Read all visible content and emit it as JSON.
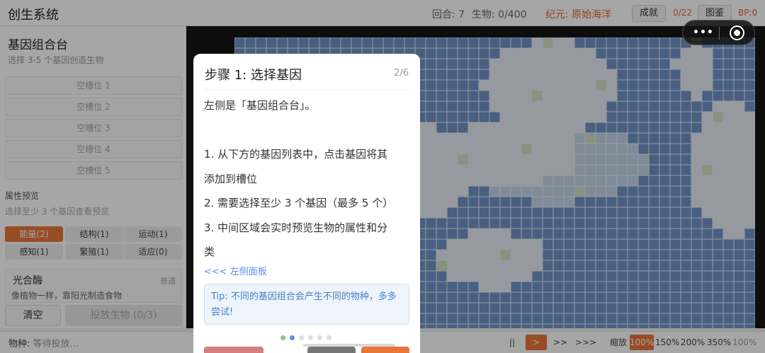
{
  "header": {
    "title": "创生系统",
    "round": "回合: 7",
    "creatures": "生物: 0/400",
    "era": "纪元: 原始海洋",
    "achievements_label": "成就",
    "achievements_count": "0/22",
    "codex_label": "图鉴",
    "bp": "BP:0"
  },
  "gene_panel": {
    "title": "基因组合台",
    "subtitle": "选择 3-5 个基因创造生物",
    "slots": [
      "空槽位 1",
      "空槽位 2",
      "空槽位 3",
      "空槽位 4",
      "空槽位 5"
    ],
    "preview_title": "属性预览",
    "preview_hint": "选择至少 3 个基因查看预览",
    "categories": [
      "能量(2)",
      "结构(1)",
      "运动(1)",
      "感知(1)",
      "繁殖(1)",
      "适应(0)"
    ],
    "active_category": "能量(2)",
    "gene": {
      "name": "光合酶",
      "tag": "普通",
      "description": "像植物一样，靠阳光制造食物"
    },
    "clear_label": "清空",
    "release_label": "投放生物 (0/3)"
  },
  "bottom_bar": {
    "species_label": "物种:",
    "species_value": "等待投放...",
    "pause": "||",
    "speed1": ">",
    "speed2": ">>",
    "speed3": ">>>",
    "zoom_label": "缩放",
    "zoom_options": [
      "100%",
      "150%",
      "200%",
      "350%",
      "100%"
    ],
    "active_zoom": "100%"
  },
  "tutorial": {
    "title": "步骤 1: 选择基因",
    "step": "2/6",
    "lines": [
      "左侧是「基因组合台」。",
      "1. 从下方的基因列表中，点击基因将其",
      "添加到槽位",
      "2. 需要选择至少 3 个基因（最多 5 个）",
      "3. 中间区域会实时预览生物的属性和分",
      "类"
    ],
    "link": "<<< 左侧面板",
    "tip": "Tip: 不同的基因组合会产生不同的物种，多多尝试!",
    "page_count": 6,
    "current_page": 2,
    "colors": {
      "accent": "#e8753a",
      "tip_text": "#4a7fc0",
      "link": "#5b8def"
    }
  },
  "map_colors": {
    "ocean": "#6f93c7",
    "land": "#e6ecf4",
    "shallow": "#c5d6ea",
    "algae": "#cfe0c4"
  }
}
